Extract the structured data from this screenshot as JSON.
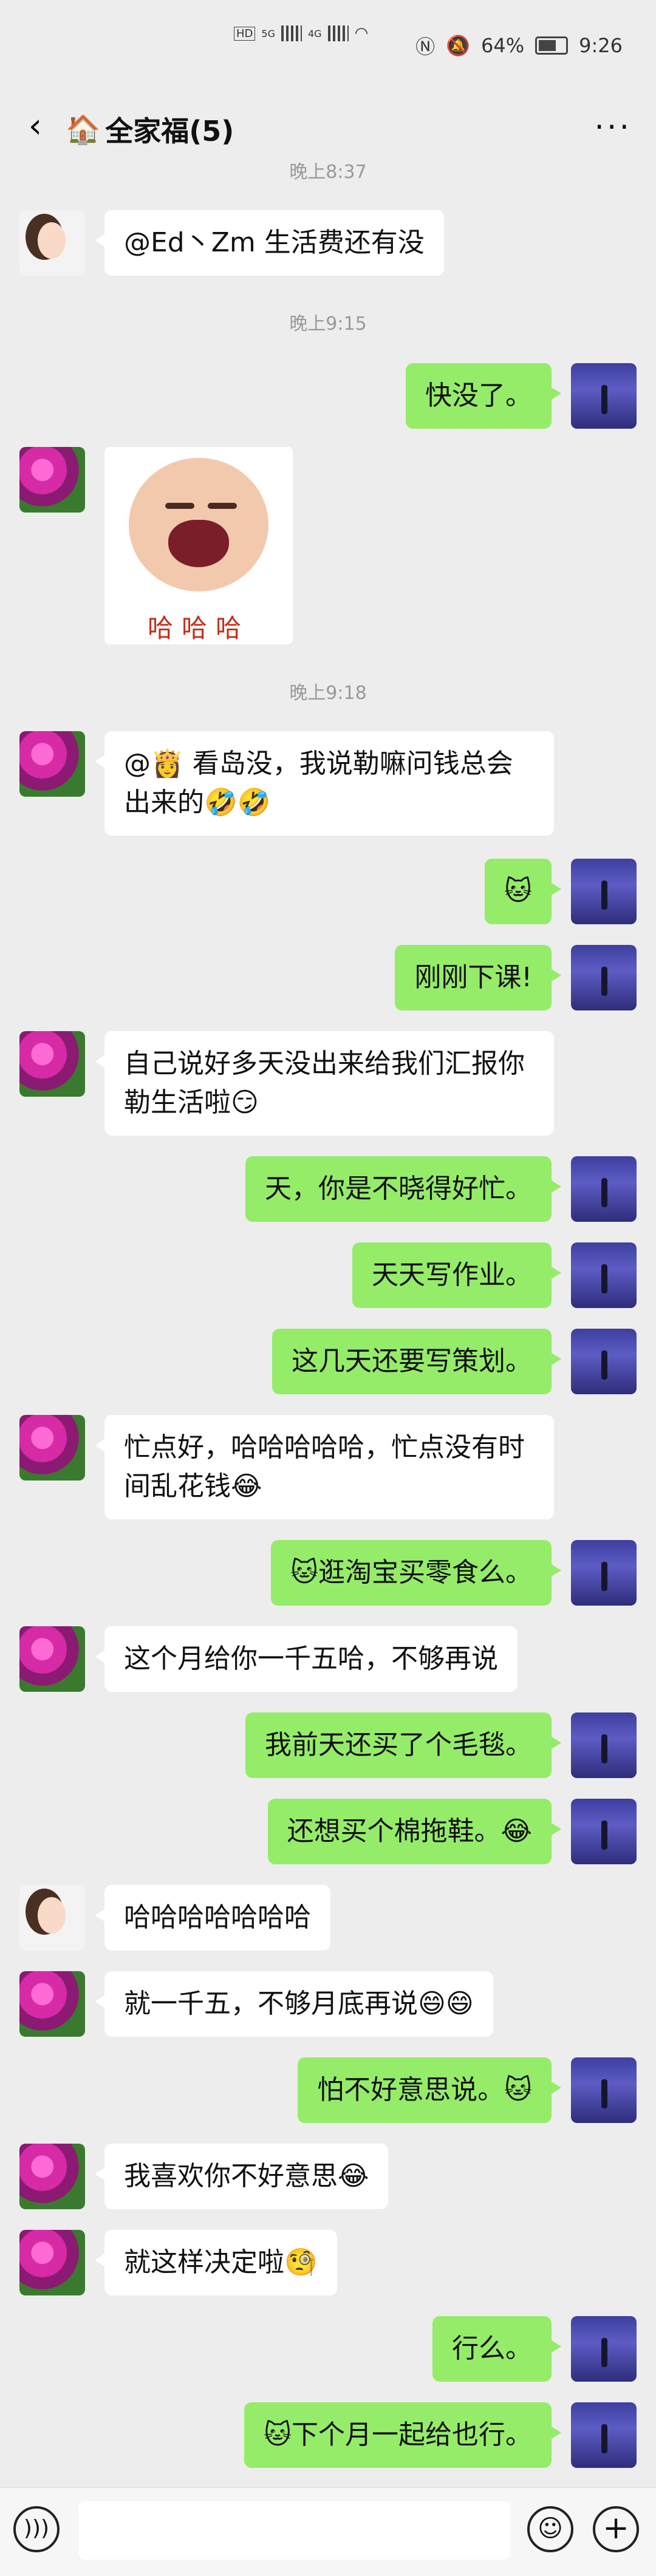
{
  "status_bar": {
    "net1": "HD",
    "net2": "HD",
    "gen1": "5G",
    "gen2": "4G",
    "battery": "64%",
    "time": "9:26"
  },
  "header": {
    "title_icon": "🏠",
    "title": "全家福(5)",
    "more": "···"
  },
  "timestamps": [
    "晚上8:37",
    "晚上9:15",
    "晚上9:18"
  ],
  "messages": [
    {
      "side": "left",
      "avatar": "girl",
      "text": "@Ed丶Zm 生活费还有没"
    },
    {
      "side": "right",
      "avatar": "night",
      "text": "快没了。"
    },
    {
      "side": "left",
      "avatar": "flower",
      "sticker": "baby-laughing",
      "sticker_text": "哈哈哈"
    },
    {
      "side": "left",
      "avatar": "flower",
      "text": "@👸 看岛没，我说勒嘛问钱总会出来的🤣🤣"
    },
    {
      "side": "right",
      "avatar": "night",
      "text": "🐱"
    },
    {
      "side": "right",
      "avatar": "night",
      "text": "刚刚下课!"
    },
    {
      "side": "left",
      "avatar": "flower",
      "text": "自己说好多天没出来给我们汇报你勒生活啦😏"
    },
    {
      "side": "right",
      "avatar": "night",
      "text": "天，你是不晓得好忙。"
    },
    {
      "side": "right",
      "avatar": "night",
      "text": "天天写作业。"
    },
    {
      "side": "right",
      "avatar": "night",
      "text": "这几天还要写策划。"
    },
    {
      "side": "left",
      "avatar": "flower",
      "text": "忙点好，哈哈哈哈哈，忙点没有时间乱花钱😂"
    },
    {
      "side": "right",
      "avatar": "night",
      "text": "🐱逛淘宝买零食么。"
    },
    {
      "side": "left",
      "avatar": "flower",
      "text": "这个月给你一千五哈，不够再说"
    },
    {
      "side": "right",
      "avatar": "night",
      "text": "我前天还买了个毛毯。"
    },
    {
      "side": "right",
      "avatar": "night",
      "text": "还想买个棉拖鞋。😂"
    },
    {
      "side": "left",
      "avatar": "girl",
      "text": "哈哈哈哈哈哈哈"
    },
    {
      "side": "left",
      "avatar": "flower",
      "text": "就一千五，不够月底再说😄😄"
    },
    {
      "side": "right",
      "avatar": "night",
      "text": "怕不好意思说。🐱"
    },
    {
      "side": "left",
      "avatar": "flower",
      "text": "我喜欢你不好意思😂"
    },
    {
      "side": "left",
      "avatar": "flower",
      "text": "就这样决定啦🧐"
    },
    {
      "side": "right",
      "avatar": "night",
      "text": "行么。"
    },
    {
      "side": "right",
      "avatar": "night",
      "text": "🐱下个月一起给也行。"
    }
  ],
  "input_bar": {
    "voice_icon": "voice-icon",
    "emoji_icon": "emoji-icon",
    "plus_icon": "plus-icon"
  }
}
